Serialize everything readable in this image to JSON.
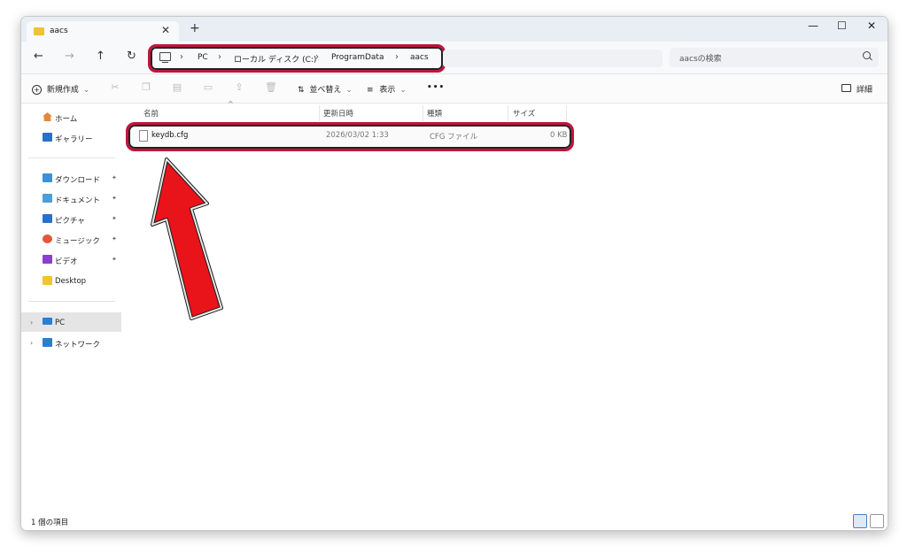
{
  "tab": {
    "title": "aacs",
    "close": "✕",
    "new": "+"
  },
  "window_controls": {
    "minimize": "—",
    "maximize": "☐",
    "close": "✕"
  },
  "nav": {
    "back": "←",
    "forward": "→",
    "up": "↑",
    "refresh": "↻"
  },
  "breadcrumb": [
    "PC",
    "ローカル ディスク (C:)",
    "ProgramData",
    "aacs"
  ],
  "breadcrumb_sep": "›",
  "search": {
    "placeholder": "aacsの検索"
  },
  "toolbar": {
    "new_label": "新規作成",
    "sort_label": "並べ替え",
    "view_label": "表示",
    "more_label": "•••",
    "details_label": "詳細",
    "dropdown": "⌄"
  },
  "sidebar": {
    "home": "ホーム",
    "gallery": "ギャラリー",
    "quick": [
      {
        "label": "ダウンロード"
      },
      {
        "label": "ドキュメント"
      },
      {
        "label": "ピクチャ"
      },
      {
        "label": "ミュージック"
      },
      {
        "label": "ビデオ"
      },
      {
        "label": "Desktop"
      }
    ],
    "pc": "PC",
    "network": "ネットワーク",
    "pin": "✦"
  },
  "columns": {
    "name": "名前",
    "modified": "更新日時",
    "type": "種類",
    "size": "サイズ"
  },
  "files": [
    {
      "name": "keydb.cfg",
      "modified": "2026/03/02 1:33",
      "type": "CFG ファイル",
      "size": "0 KB"
    }
  ],
  "status": {
    "count": "1 個の項目"
  },
  "colors": {
    "highlight": "#c0143c",
    "arrow": "#e8141a",
    "folder": "#f1c232"
  }
}
